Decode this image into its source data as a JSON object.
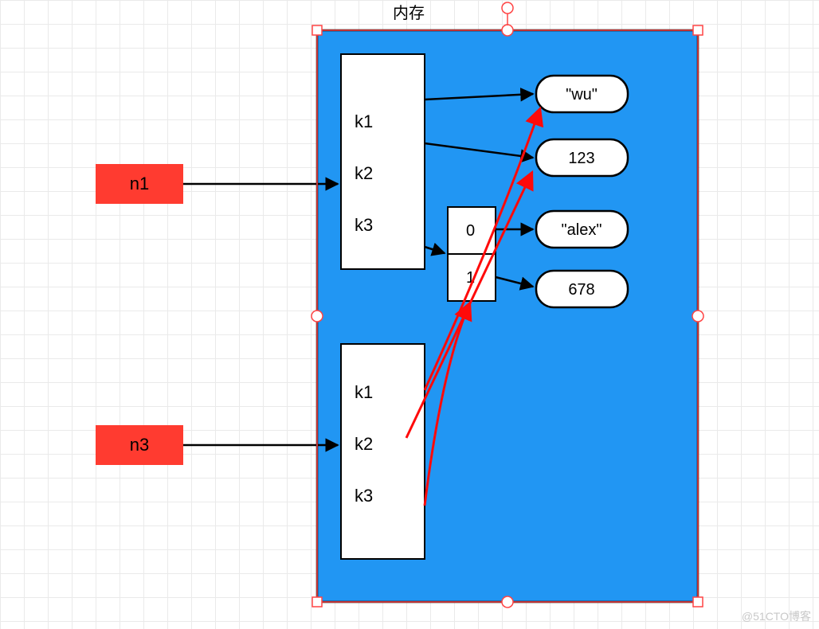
{
  "title": "内存",
  "variables": {
    "n1": "n1",
    "n3": "n3"
  },
  "dict1": {
    "keys": [
      "k1",
      "k2",
      "k3"
    ]
  },
  "dict3": {
    "keys": [
      "k1",
      "k2",
      "k3"
    ]
  },
  "list": {
    "indices": [
      "0",
      "1"
    ]
  },
  "values": {
    "wu": "\"wu\"",
    "v123": "123",
    "alex": "\"alex\"",
    "v678": "678"
  },
  "colors": {
    "memory_bg": "#2196F3",
    "variable_bg": "#FF3B30",
    "box_bg": "#FFFFFF",
    "stroke": "#000000",
    "accent_arrow": "#FF0A0A",
    "selection": "#FF4444",
    "handle_fill": "#FFFFFF"
  },
  "watermark": "@51CTO博客"
}
